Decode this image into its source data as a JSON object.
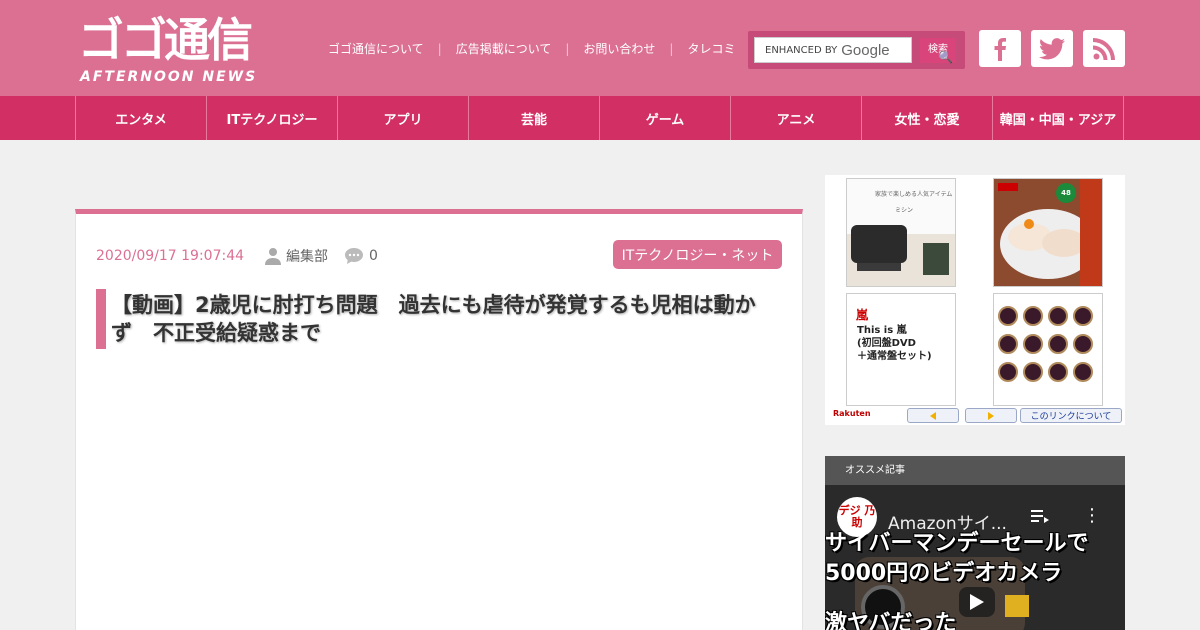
{
  "header": {
    "logo_main": "ゴゴ通信",
    "logo_sub": "AFTERNOON NEWS",
    "links": [
      "ゴゴ通信について",
      "広告掲載について",
      "お問い合わせ",
      "タレコミ"
    ],
    "search_prefix": "ENHANCED BY",
    "search_brand": "Google",
    "search_button": "検索",
    "social": [
      "facebook-icon",
      "twitter-icon",
      "rss-icon"
    ],
    "accent_color": "#db7093"
  },
  "nav": {
    "items": [
      "エンタメ",
      "ITテクノロジー",
      "アプリ",
      "芸能",
      "ゲーム",
      "アニメ",
      "女性・恋愛",
      "韓国・中国・アジア"
    ],
    "color": "#d22f64"
  },
  "article": {
    "date": "2020/09/17 19:07:44",
    "author": "編集部",
    "comments": "0",
    "category": "ITテクノロジー・ネット",
    "title": "【動画】2歳児に肘打ち問題　過去にも虐待が発覚するも児相は動かず　不正受給疑惑まで"
  },
  "ad": {
    "tile1_text": "家族で楽しめる人気アイテム",
    "tile1_sub": "ミシン",
    "tile2_badge": "48",
    "tile3_title": "嵐",
    "tile3_line1": "This is 嵐",
    "tile3_line2": "(初回盤DVD",
    "tile3_line3": "＋通常盤セット)",
    "brand": "Rakuten",
    "link_label": "このリンクについて"
  },
  "recommend": {
    "header": "オススメ記事",
    "video_channel": "デジ 乃助",
    "video_title": "Amazonサイ...",
    "caption1": "サイバーマンデーセールで",
    "caption2": "5000円のビデオカメラ",
    "caption3": "激ヤバだった"
  }
}
